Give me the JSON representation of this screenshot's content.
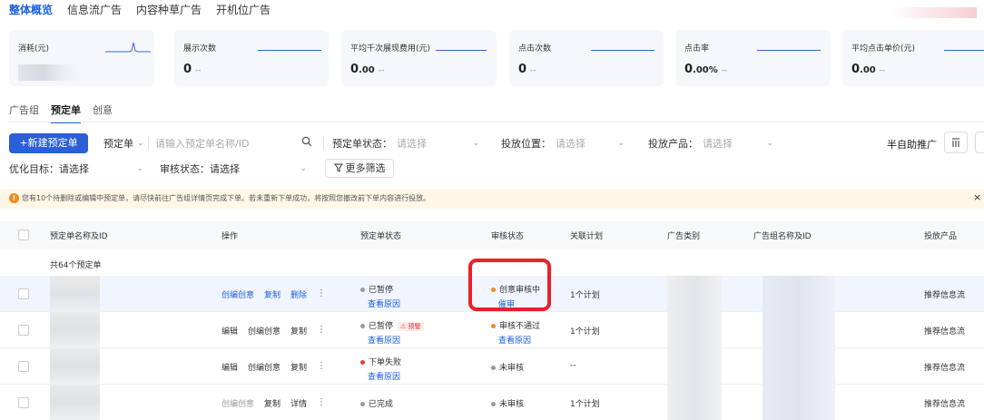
{
  "top_tabs": [
    "整体概览",
    "信息流广告",
    "内容种草广告",
    "开机位广告"
  ],
  "metrics": [
    {
      "label": "消耗(元)",
      "value": "",
      "unit": "",
      "dash": ""
    },
    {
      "label": "展示次数",
      "value": "0",
      "unit": "",
      "dash": "--"
    },
    {
      "label": "平均千次展现费用(元)",
      "value": "0",
      "unit": ".00",
      "dash": "--"
    },
    {
      "label": "点击次数",
      "value": "0",
      "unit": "",
      "dash": "--"
    },
    {
      "label": "点击率",
      "value": "0",
      "unit": ".00%",
      "dash": "--"
    },
    {
      "label": "平均点击单价(元)",
      "value": "0",
      "unit": ".00",
      "dash": "--"
    }
  ],
  "sub_tabs": [
    "广告组",
    "预定单",
    "创意"
  ],
  "toolbar": {
    "new_button": "+新建预定单",
    "type_select": "预定单",
    "search_placeholder": "请输入预定单名称/ID",
    "status_label": "预定单状态：",
    "position_label": "投放位置：",
    "product_label": "投放产品：",
    "placeholder": "请选择",
    "semi_auto": "半自助推广",
    "opt_label": "优化目标：",
    "audit_label": "审核状态：",
    "more_filter": "更多筛选"
  },
  "notice": {
    "text": "您有10个待删除或编辑中预定单，请尽快前往广告组详情页完成下单。若未重新下单成功，将按照您撤改前下单内容进行投放。"
  },
  "table": {
    "headers": [
      "预定单名称及ID",
      "操作",
      "预定单状态",
      "审核状态",
      "关联计划",
      "广告类别",
      "广告组名称及ID",
      "投放产品"
    ],
    "total": "共64个预定单",
    "rows": [
      {
        "ops": [
          "创编创意",
          "复制",
          "删除"
        ],
        "status": "已暂停",
        "status_sub": "查看原因",
        "badge": "",
        "audit": "创意审核中",
        "audit_sub": "催审",
        "plan": "1个计划",
        "product": "推荐信息流"
      },
      {
        "ops": [
          "编辑",
          "创编创意",
          "复制"
        ],
        "status": "已暂停",
        "status_sub": "查看原因",
        "badge": "预警",
        "audit": "审核不通过",
        "audit_sub": "查看原因",
        "plan": "1个计划",
        "product": "推荐信息流"
      },
      {
        "ops": [
          "编辑",
          "创编创意",
          "复制"
        ],
        "status": "下单失败",
        "status_sub": "查看原因",
        "badge": "",
        "audit": "未审核",
        "audit_sub": "",
        "plan": "--",
        "product": "推荐信息流"
      },
      {
        "ops": [
          "创编创意",
          "复制",
          "详情"
        ],
        "status": "已完成",
        "status_sub": "",
        "badge": "",
        "audit": "未审核",
        "audit_sub": "",
        "plan": "1个计划",
        "product": "推荐信息流"
      }
    ]
  },
  "colors": {
    "primary": "#2a5fd6",
    "paused": "#999999",
    "failed": "#e23b3b",
    "audit_pending": "#f08c1a",
    "audit_none": "#999999",
    "highlight": "#e8212b"
  }
}
